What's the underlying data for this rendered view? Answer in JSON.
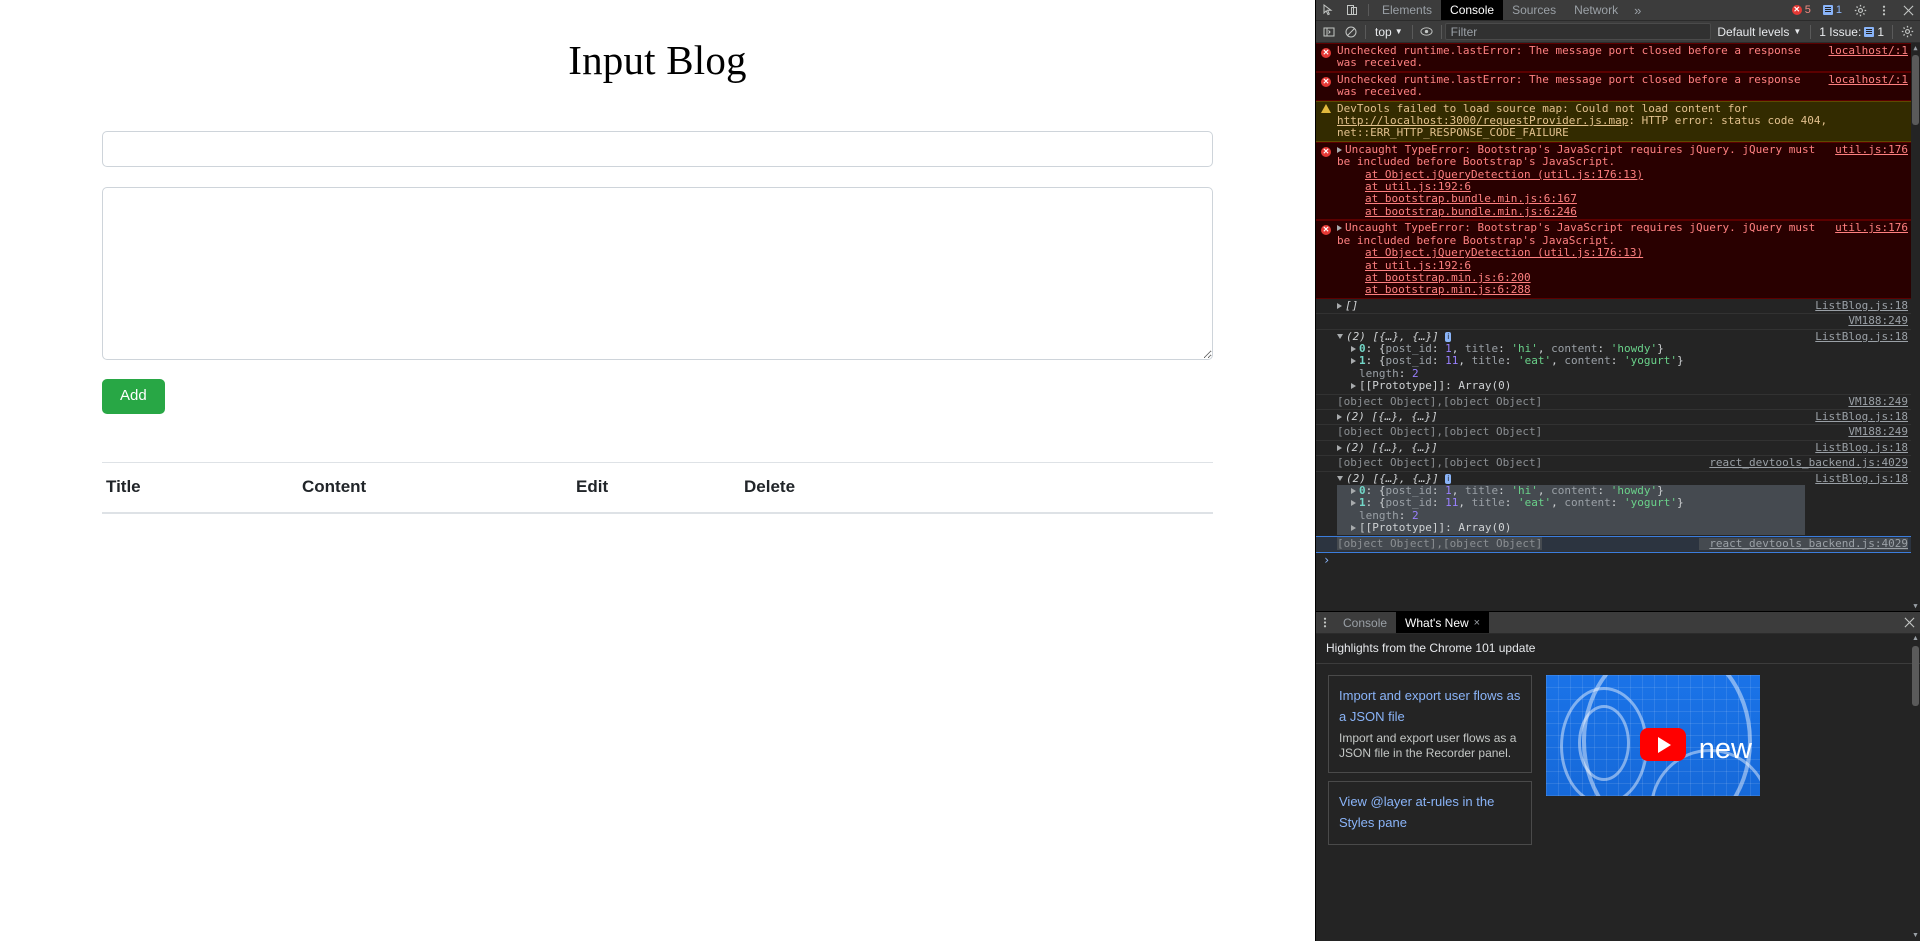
{
  "page": {
    "title": "Input Blog",
    "title_input": {
      "value": "",
      "placeholder": ""
    },
    "content_textarea": {
      "value": "",
      "placeholder": ""
    },
    "add_button": "Add",
    "table": {
      "columns": [
        "Title",
        "Content",
        "Edit",
        "Delete"
      ],
      "rows": []
    }
  },
  "devtools": {
    "top_tabs": [
      "Elements",
      "Console",
      "Sources",
      "Network"
    ],
    "active_tab": "Console",
    "more_tabs_glyph": "»",
    "error_count": "5",
    "message_count": "1",
    "settings_icon": "gear-icon",
    "menu_icon": "kebab-menu-icon",
    "close_icon": "close-icon",
    "inspect_icon": "inspect-element-icon",
    "device_icon": "device-toolbar-icon",
    "filter_bar": {
      "sidebar_icon": "console-sidebar-icon",
      "clear_icon": "clear-console-icon",
      "context": "top",
      "eye_icon": "live-expression-icon",
      "filter_placeholder": "Filter",
      "filter_value": "",
      "levels": "Default levels",
      "issues_label": "1 Issue:",
      "issues_count": "1",
      "settings_icon": "gear-icon"
    },
    "console_logs": [
      {
        "kind": "error",
        "icon": "error-icon",
        "text": "Unchecked runtime.lastError: The message port closed before a response was received.",
        "source": "localhost/:1"
      },
      {
        "kind": "error",
        "icon": "error-icon",
        "text": "Unchecked runtime.lastError: The message port closed before a response was received.",
        "source": "localhost/:1"
      },
      {
        "kind": "warn",
        "icon": "warning-icon",
        "text_a": "DevTools failed to load source map: Could not load content for ",
        "link": "http://localhost:3000/requestProvider.js.map",
        "text_b": ": HTTP error: status code 404, net::ERR_HTTP_RESPONSE_CODE_FAILURE",
        "source": ""
      },
      {
        "kind": "error",
        "icon": "error-icon",
        "expandable": true,
        "text": "Uncaught TypeError: Bootstrap's JavaScript requires jQuery. jQuery must be included before Bootstrap's JavaScript.",
        "stack": [
          "at Object.jQueryDetection (util.js:176:13)",
          "at util.js:192:6",
          "at bootstrap.bundle.min.js:6:167",
          "at bootstrap.bundle.min.js:6:246"
        ],
        "source": "util.js:176"
      },
      {
        "kind": "error",
        "icon": "error-icon",
        "expandable": true,
        "text": "Uncaught TypeError: Bootstrap's JavaScript requires jQuery. jQuery must be included before Bootstrap's JavaScript.",
        "stack": [
          "at Object.jQueryDetection (util.js:176:13)",
          "at util.js:192:6",
          "at bootstrap.min.js:6:200",
          "at bootstrap.min.js:6:288"
        ],
        "source": "util.js:176"
      },
      {
        "kind": "array_empty",
        "text": "[]",
        "source": "ListBlog.js:18"
      },
      {
        "kind": "blank",
        "text": "",
        "source": "VM188:249"
      },
      {
        "kind": "array_expanded",
        "summary": "(2) [{…}, {…}]",
        "info_badge": "i",
        "entries": [
          {
            "index": "0",
            "post_id": "1",
            "title": "'hi'",
            "content": "'howdy'"
          },
          {
            "index": "1",
            "post_id": "11",
            "title": "'eat'",
            "content": "'yogurt'"
          }
        ],
        "length_label": "length",
        "length_value": "2",
        "prototype": "[[Prototype]]: Array(0)",
        "source": "ListBlog.js:18"
      },
      {
        "kind": "dim",
        "text": "[object Object],[object Object]",
        "source": "VM188:249"
      },
      {
        "kind": "array_collapsed",
        "summary": "(2) [{…}, {…}]",
        "source": "ListBlog.js:18"
      },
      {
        "kind": "dim",
        "text": "[object Object],[object Object]",
        "source": "VM188:249"
      },
      {
        "kind": "array_collapsed",
        "summary": "(2) [{…}, {…}]",
        "source": "ListBlog.js:18"
      },
      {
        "kind": "dim",
        "text": "[object Object],[object Object]",
        "source": "react_devtools_backend.js:4029"
      },
      {
        "kind": "array_expanded_selected",
        "summary": "(2) [{…}, {…}]",
        "info_badge": "i",
        "entries": [
          {
            "index": "0",
            "post_id": "1",
            "title": "'hi'",
            "content": "'howdy'"
          },
          {
            "index": "1",
            "post_id": "11",
            "title": "'eat'",
            "content": "'yogurt'"
          }
        ],
        "length_label": "length",
        "length_value": "2",
        "prototype": "[[Prototype]]: Array(0)",
        "source": "ListBlog.js:18"
      },
      {
        "kind": "dim_selected",
        "text": "[object Object],[object Object]",
        "source": "react_devtools_backend.js:4029"
      }
    ],
    "prompt_glyph": "›",
    "drawer": {
      "menu_icon": "kebab-menu-icon",
      "tabs": [
        {
          "label": "Console",
          "active": false,
          "closable": false
        },
        {
          "label": "What's New",
          "active": true,
          "closable": true
        }
      ],
      "close_glyph": "×",
      "drawer_close_icon": "close-icon",
      "whats_new": {
        "heading": "Highlights from the Chrome 101 update",
        "cards": [
          {
            "title": "Import and export user flows as a JSON file",
            "desc": "Import and export user flows as a JSON file in the Recorder panel."
          },
          {
            "title": "View @layer at-rules in the Styles pane",
            "desc": ""
          }
        ],
        "video": {
          "overlay_text": "new",
          "play_icon": "youtube-play-icon"
        }
      }
    }
  }
}
